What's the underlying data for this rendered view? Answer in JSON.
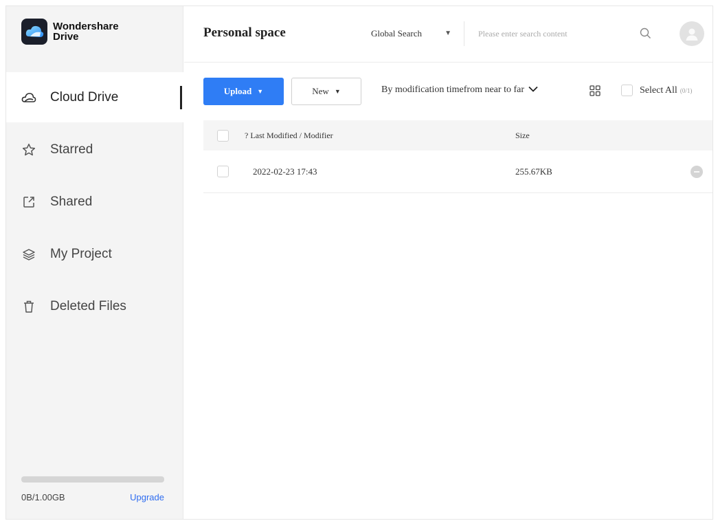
{
  "brand": {
    "line1": "Wondershare",
    "line2": "Drive"
  },
  "sidebar": {
    "items": [
      {
        "label": "Cloud Drive",
        "icon": "cloud-icon",
        "active": true
      },
      {
        "label": "Starred",
        "icon": "star-icon",
        "active": false
      },
      {
        "label": "Shared",
        "icon": "share-icon",
        "active": false
      },
      {
        "label": "My Project",
        "icon": "layers-icon",
        "active": false
      },
      {
        "label": "Deleted Files",
        "icon": "trash-icon",
        "active": false
      }
    ],
    "storage": {
      "used": "0B/1.00GB",
      "upgrade": "Upgrade",
      "used_fraction": 0
    }
  },
  "header": {
    "title": "Personal space",
    "scope": "Global Search",
    "search_placeholder": "Please enter search content"
  },
  "toolbar": {
    "upload": "Upload",
    "new": "New",
    "sort": "By modification timefrom near to far",
    "select_all": "Select All",
    "select_count": "(0/1)"
  },
  "table": {
    "columns": {
      "modified": "? Last Modified / Modifier",
      "size": "Size"
    },
    "rows": [
      {
        "modified": "2022-02-23 17:43",
        "size": "255.67KB"
      }
    ]
  },
  "colors": {
    "accent": "#2f7df5",
    "upgrade_link": "#2f6df0",
    "sidebar_bg": "#f4f4f4"
  }
}
